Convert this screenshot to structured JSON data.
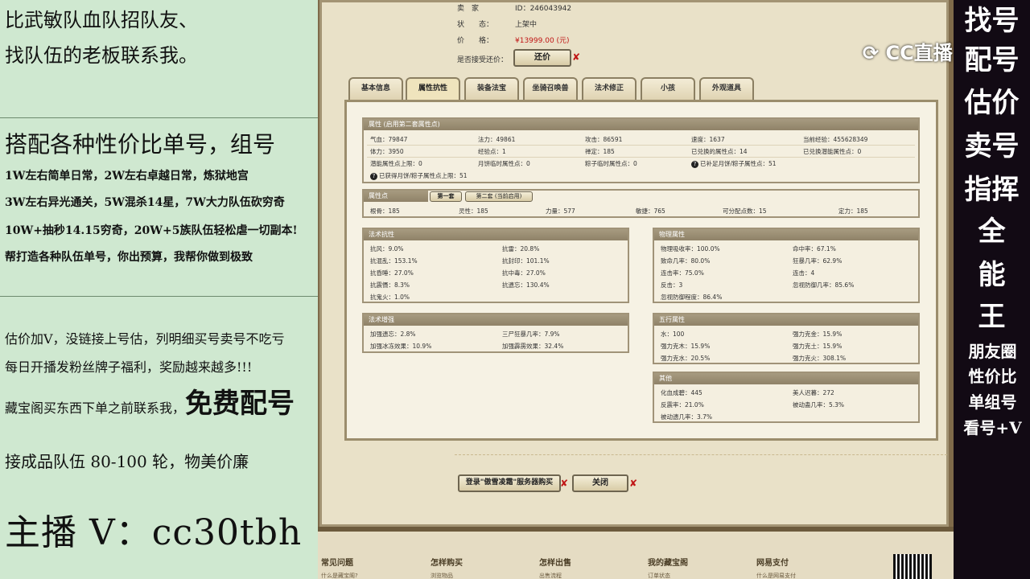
{
  "left": {
    "line1": "比武敏队血队招队友、",
    "line2": "找队伍的老板联系我。",
    "heading": "搭配各种性价比单号，组号",
    "services": [
      "1W左右简单日常，2W左右卓越日常，炼狱地宫",
      "3W左右异光通关，5W混杀14星，7W大力队伍砍穷奇",
      "10W+抽秒14.15穷奇，20W+5族队伍轻松虐一切副本!",
      "帮打造各种队伍单号，你出预算，我帮你做到极致"
    ],
    "notes": [
      "估价加V，没链接上号估，列明细买号卖号不吃亏",
      "每日开播发粉丝牌子福利，奖励越来越多!!!"
    ],
    "free_line_prefix": "藏宝阁买东西下单之前联系我，",
    "free_line_big": "免费配号",
    "team_line": "接成品队伍 80-100 轮，物美价廉",
    "host": "主播 V：cc30tbh"
  },
  "header": {
    "seller_label": "卖　家",
    "seller_value": "ID：246043942",
    "status_label": "状　　态：",
    "status_value": "上架中",
    "price_label": "价　　格：",
    "price_value": "¥13999.00 (元)",
    "bargain_label": "是否接受还价：",
    "bargain_button": "还价"
  },
  "tabs": [
    "基本信息",
    "属性抗性",
    "装备法宝",
    "坐骑召唤兽",
    "法术修正",
    "小孩",
    "外观道具"
  ],
  "active_tab": 1,
  "attrs": {
    "title": "属性 (启用第二套属性点)",
    "rows": [
      [
        "气血：79847",
        "法力：49861",
        "攻击：86591",
        "速度：1637",
        "当前经验：455628349"
      ],
      [
        "体力：3950",
        "经验点：1",
        "禅定：185",
        "已兑换的属性点：14",
        "已兑换潜能属性点：0"
      ],
      [
        "潜能属性点上限：0",
        "月饼临时属性点：0",
        "粽子临时属性点：0",
        "已补足月饼/粽子属性点：51",
        ""
      ],
      [
        "已获得月饼/粽子属性点上限：51",
        "",
        "",
        "",
        ""
      ]
    ]
  },
  "points": {
    "title": "属性点",
    "tab1": "第一套",
    "tab2": "第二套 (当前启用)",
    "values": [
      "根骨：185",
      "灵性：185",
      "力量：577",
      "敏捷：765",
      "可分配点数：15",
      "定力：185"
    ]
  },
  "resist": {
    "title": "法术抗性",
    "items": [
      "抗风：9.0%",
      "抗雷：20.8%",
      "抗混乱：153.1%",
      "抗封印：101.1%",
      "抗昏睡：27.0%",
      "抗中毒：27.0%",
      "抗震慑：8.3%",
      "抗遗忘：130.4%",
      "抗鬼火：1.0%",
      ""
    ]
  },
  "boost": {
    "title": "法术增强",
    "items": [
      "加强遗忘：2.8%",
      "三尸狂暴几率：7.9%",
      "加强冰冻效果：10.9%",
      "加强霹雳效果：32.4%"
    ]
  },
  "physical": {
    "title": "物理属性",
    "items": [
      "物理吸收率：100.0%",
      "命中率：67.1%",
      "致命几率：80.0%",
      "狂暴几率：62.9%",
      "连击率：75.0%",
      "连击：4",
      "反击：3",
      "忽视防御几率：85.6%",
      "忽视防御程度：86.4%",
      ""
    ]
  },
  "elements": {
    "title": "五行属性",
    "items": [
      "水：100",
      "强力克金：15.9%",
      "强力克木：15.9%",
      "强力克土：15.9%",
      "强力克水：20.5%",
      "强力克火：308.1%"
    ]
  },
  "other": {
    "title": "其他",
    "items": [
      "化血成碧：445",
      "美人迟暮：272",
      "反震率：21.0%",
      "被动蛊几率：5.3%",
      "被动遗几率：3.7%",
      ""
    ]
  },
  "actions": {
    "login_buy": "登录\"傲雪凌霜\"服务器购买",
    "close": "关闭"
  },
  "footer": {
    "cols": [
      {
        "title": "常见问题",
        "sub": "什么是藏宝阁?"
      },
      {
        "title": "怎样购买",
        "sub": "浏览物品"
      },
      {
        "title": "怎样出售",
        "sub": "出售流程"
      },
      {
        "title": "我的藏宝阁",
        "sub": "订单状态"
      },
      {
        "title": "网易支付",
        "sub": "什么是网易支付"
      }
    ]
  },
  "right": {
    "big": [
      "找号",
      "配号",
      "估价",
      "卖号",
      "指挥",
      "全",
      "能",
      "王"
    ],
    "small": [
      "朋友圈",
      "性价比",
      "单组号",
      "看号+V"
    ],
    "logo": "CC直播"
  }
}
